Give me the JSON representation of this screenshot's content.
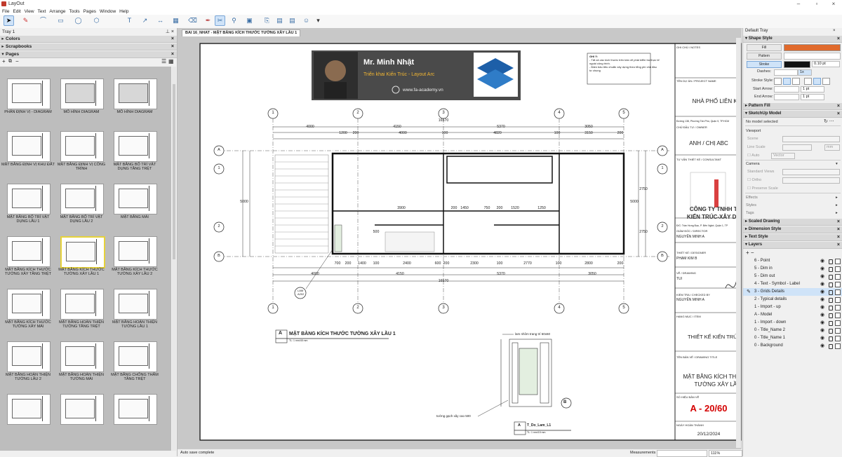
{
  "app": {
    "title": "LayOut"
  },
  "menu": [
    "File",
    "Edit",
    "View",
    "Text",
    "Arrange",
    "Tools",
    "Pages",
    "Window",
    "Help"
  ],
  "left_tray": {
    "title": "Tray 1",
    "panels": {
      "colors": "Colors",
      "scrapbooks": "Scrapbooks",
      "pages": "Pages"
    },
    "pages": [
      {
        "label": "PHÂN ĐỊNH VỊ - DIAGRAM"
      },
      {
        "label": "MÔ HÌNH DIAGRAM"
      },
      {
        "label": "MÔ HÌNH DIAGRAM"
      },
      {
        "label": "MẶT BẰNG ĐỊNH VỊ KHU ĐẤT"
      },
      {
        "label": "MẶT BẰNG ĐỊNH VỊ CÔNG TRÌNH"
      },
      {
        "label": "MẶT BẰNG BỐ TRÍ VẬT DỤNG TẦNG TRỆT"
      },
      {
        "label": "MẶT BẰNG BỐ TRÍ VẬT DỤNG LẦU 1"
      },
      {
        "label": "MẶT BẰNG BỐ TRÍ VẬT DỤNG LẦU 2"
      },
      {
        "label": "MẶT BẰNG MÁI"
      },
      {
        "label": "MẶT BẰNG KÍCH THƯỚC TƯỜNG XÂY TẦNG TRỆT"
      },
      {
        "label": "MẶT BẰNG KÍCH THƯỚC TƯỜNG XÂY LẦU 1"
      },
      {
        "label": "MẶT BẰNG KÍCH THƯỚC TƯỜNG XÂY LẦU 2"
      },
      {
        "label": "MẶT BẰNG KÍCH THƯỚC TƯỜNG XÂY MÁI"
      },
      {
        "label": "MẶT BẰNG HOÀN THIỆN TƯỜNG TẦNG TRỆT"
      },
      {
        "label": "MẶT BẰNG HOÀN THIỆN TƯỜNG LẦU 1"
      },
      {
        "label": "MẶT BẰNG HOÀN THIỆN TƯỜNG LẦU 2"
      },
      {
        "label": "MẶT BẰNG HOÀN THIỆN TƯỜNG MÁI"
      },
      {
        "label": "MẶT BẰNG CHỐNG THẤM TẦNG TRỆT"
      },
      {
        "label": ""
      },
      {
        "label": ""
      },
      {
        "label": ""
      }
    ]
  },
  "document": {
    "tab": "BAI 16_NHAT - MẶT BẰNG KÍCH THƯỚC TƯỜNG XÂY LẦU 1",
    "banner": {
      "name": "Mr. Minh Nhật",
      "subtitle": "Triển khai Kiến Trúc - Layout Arc",
      "site": "www.fa-academy.vn"
    },
    "note": {
      "title": "GHI Ý:",
      "lines": [
        "- Tất cả các kích thước trên bản vẽ phải kiểm tra thực tế",
        "ngoài công trình.",
        "- Đảm bảo tiêu chuẩn xây dựng theo tổng phí chủ đầu",
        "tư chung"
      ]
    },
    "grid_top": [
      "1",
      "2",
      "3",
      "4",
      "5"
    ],
    "grid_side": [
      "A",
      "1",
      "2",
      "B"
    ],
    "dims_top": [
      "16570",
      "4000",
      "4150",
      "5370",
      "3050",
      "1200",
      "200",
      "4000",
      "100",
      "4820",
      "100",
      "3150",
      "200"
    ],
    "dims_bottom": [
      "700",
      "200",
      "1400",
      "100",
      "2400",
      "600",
      "200",
      "2300",
      "100",
      "2770",
      "100",
      "2800",
      "200",
      "4000",
      "4150",
      "5370",
      "3050",
      "16570"
    ],
    "dims_inner": [
      "3900",
      "200",
      "1450",
      "750",
      "200",
      "1520",
      "1250",
      "500",
      "2750",
      "2750",
      "5000",
      "5000"
    ],
    "drawing_title": "MẶT BẰNG KÍCH THƯỚC TƯỜNG XÂY LẦU 1",
    "drawing_tag": "A",
    "drawing_scale": "TL: 1 mm/45 mm",
    "detail_tag": "B",
    "detail_label_top": "lam nhôm trang trí 60x60",
    "detail_label_bottom": "tường gạch xây cao 500",
    "detail_title": "T_Do_Lam_L1",
    "detail_scale": "TL: 1 mm/15 mm",
    "callout": {
      "top": "LAM",
      "bottom": "A202"
    },
    "titleblock": {
      "notes": "GHI CHÚ / NOTES",
      "project_lbl": "TÊN DỰ ÁN / PROJECT NAME",
      "project": "NHÀ PHỐ LIÊN KẾ",
      "address": "Đường 138, Phường Tân Phú, Quận 9, TP.HCM",
      "owner_lbl": "CHỦ ĐẦU TƯ / OWNER",
      "owner": "ANH / CHỊ ABC",
      "consult_lbl": "TƯ VẤN THIẾT KẾ / CONSULTANT",
      "company1": "CÔNG TY TNHH TV",
      "company2": "KIẾN TRÚC-XÂY DỰ",
      "company_addr": "Đ/C: Trần Hưng Đạo, P. Bến Nghé, Quận 1, TP",
      "director_lbl": "GIÁM ĐỐC / DIRECTOR",
      "director": "NGUYỄN MINH A",
      "designer_lbl": "THIẾT KẾ / DESIGNER",
      "designer": "PHẠM KIM B",
      "drawing_lbl": "VẼ / DRAWING",
      "drawing": "TUI",
      "checked_lbl": "KIỂM TRA / CHECKED BY",
      "checked": "NGUYỄN MINH A",
      "item_lbl": "HẠNG MỤC / ITEM",
      "item": "THIẾT KẾ KIẾN TRÚC",
      "dtitle_lbl": "TÊN BẢN VẼ / DRAWING TITLE",
      "dtitle1": "MẶT BẰNG KÍCH THƯ",
      "dtitle2": "TƯỜNG XÂY LẦU",
      "sheet_lbl": "SỐ HIỆU BẢN VẼ",
      "sheet": "A - 20/60",
      "date_lbl": "NGÀY HOÀN THÀNH",
      "date": "20/12/2024"
    }
  },
  "status": {
    "text": "Auto save complete",
    "measurements": "Measurements",
    "zoom": "111%"
  },
  "right_tray": {
    "title": "Default Tray",
    "shape_style": "Shape Style",
    "fill": "Fill",
    "pattern": "Pattern",
    "stroke": "Stroke",
    "stroke_width": "0.10 pt",
    "dashes": "Dashes:",
    "dash_scale": "1x",
    "stroke_style": "Stroke Style:",
    "start_arrow": "Start Arrow:",
    "end_arrow": "End Arrow:",
    "arrow_size": "1 pt",
    "pattern_fill": "Pattern Fill",
    "sketchup_model": "SketchUp Model",
    "no_model": "No model selected",
    "viewport": "Viewport",
    "scene": "Scene",
    "line_scale": "Line Scale",
    "line_unit": "mm",
    "auto": "Auto",
    "vector": "Vector",
    "camera": "Camera",
    "standard_views": "Standard Views",
    "ortho": "Ortho",
    "preserve_scale": "Preserve Scale",
    "effects": "Effects",
    "styles": "Styles",
    "tags": "Tags",
    "scaled_drawing": "Scaled Drawing",
    "dimension_style": "Dimension Style",
    "text_style": "Text Style",
    "layers": "Layers",
    "layer_list": [
      "6 - Point",
      "5 - Dim in",
      "5 - Dim out",
      "4 - Text - Symbol - Label",
      "3 - Grids Details",
      "2 - Typical details",
      "1 - Import - up",
      "A - Model",
      "1 - Import - down",
      "0 - Title_Name 2",
      "0 - Title_Name 1",
      "0 - Background"
    ],
    "selected_layer": 4
  },
  "colors": {
    "fill": "#e06a2c",
    "stroke": "#111111",
    "accent": "#3a6ea5",
    "sheet_red": "#d40000"
  }
}
